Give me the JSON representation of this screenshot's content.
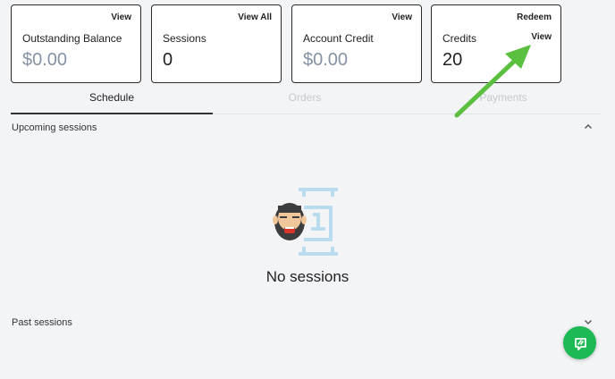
{
  "cards": [
    {
      "title": "Outstanding Balance",
      "value": "$0.00",
      "link": "View",
      "value_muted": true
    },
    {
      "title": "Sessions",
      "value": "0",
      "link": "View All",
      "value_muted": false
    },
    {
      "title": "Account Credit",
      "value": "$0.00",
      "link": "View",
      "value_muted": true
    },
    {
      "title": "Credits",
      "value": "20",
      "link": "Redeem",
      "link2": "View",
      "value_muted": false
    }
  ],
  "tabs": [
    {
      "label": "Schedule",
      "active": true
    },
    {
      "label": "Orders",
      "active": false
    },
    {
      "label": "Payments",
      "active": false
    }
  ],
  "sections": {
    "upcoming": "Upcoming sessions",
    "past": "Past sessions"
  },
  "empty_state": {
    "message": "No sessions",
    "illustration": "bearded-man-with-calendar"
  },
  "colors": {
    "accent_green": "#1db954",
    "arrow_green": "#5bbf3f",
    "muted_value": "#8592a3"
  },
  "icons": {
    "chevron_up": "chevron-up-icon",
    "chevron_down": "chevron-down-icon",
    "help": "chat-help-icon"
  }
}
